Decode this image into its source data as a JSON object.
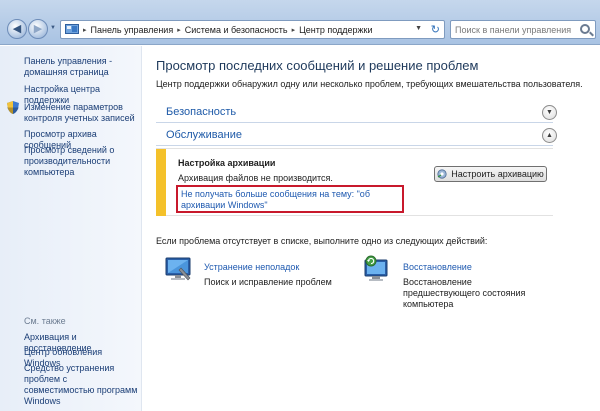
{
  "address_bar": {
    "breadcrumbs": [
      "Панель управления",
      "Система и безопасность",
      "Центр поддержки"
    ]
  },
  "search": {
    "placeholder": "Поиск в панели управления"
  },
  "sidebar": {
    "home": "Панель управления - домашняя страница",
    "links": [
      "Настройка центра поддержки",
      "Изменение параметров контроля учетных записей",
      "Просмотр архива сообщений",
      "Просмотр сведений о производительности компьютера"
    ],
    "see_also_heading": "См. также",
    "see_also": [
      "Архивация и восстановление",
      "Центр обновления Windows",
      "Средство устранения проблем с совместимостью программ Windows"
    ]
  },
  "main": {
    "title": "Просмотр последних сообщений и решение проблем",
    "subtitle": "Центр поддержки обнаружил одну или несколько проблем, требующих вмешательства пользователя.",
    "sections": [
      {
        "label": "Безопасность"
      },
      {
        "label": "Обслуживание"
      }
    ],
    "alert": {
      "title": "Настройка архивации",
      "text": "Архивация файлов не производится.",
      "link": "Не получать больше сообщения на тему: \"об архивации Windows\"",
      "button": "Настроить архивацию"
    },
    "prompt": "Если проблема отсутствует в списке, выполните одно из следующих действий:",
    "actions": [
      {
        "title": "Устранение неполадок",
        "desc": "Поиск и исправление проблем"
      },
      {
        "title": "Восстановление",
        "desc": "Восстановление предшествующего состояния компьютера"
      }
    ]
  },
  "colors": {
    "accent": "#1f5ab0",
    "warning_stripe": "#f4c12a",
    "highlight": "#c8192c"
  }
}
